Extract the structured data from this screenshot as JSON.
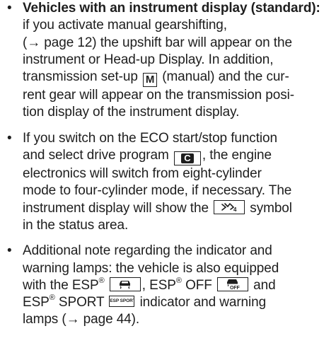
{
  "items": [
    {
      "lines": [
        {
          "parts": [
            "Vehicles with an instrument display (standard):"
          ]
        },
        {
          "parts": [
            "if you activate manual gearshifting,"
          ]
        },
        {
          "parts": [
            "(→ page 12) the upshift bar will appear on the"
          ]
        },
        {
          "parts": [
            "instrument or Head-up Display. In addition,"
          ]
        },
        {
          "parts": [
            "transmission set-up",
            "(manual) and the cur-"
          ]
        },
        {
          "parts": [
            "rent gear will appear on the transmission posi-"
          ]
        },
        {
          "parts": [
            "tion display of the instrument display."
          ]
        }
      ]
    },
    {
      "lines": [
        {
          "parts": [
            "If you switch on the ECO start/stop function"
          ]
        },
        {
          "parts": [
            "and select drive program",
            ", the engine"
          ]
        },
        {
          "parts": [
            "electronics will switch from eight-cylinder"
          ]
        },
        {
          "parts": [
            "mode to four-cylinder mode, if necessary. The"
          ]
        },
        {
          "parts": [
            "instrument display will show the",
            "symbol"
          ]
        },
        {
          "parts": [
            "in the status area."
          ]
        }
      ]
    },
    {
      "lines": [
        {
          "parts": [
            "Additional note regarding the indicator and"
          ]
        },
        {
          "parts": [
            "warning lamps: the vehicle is also equipped"
          ]
        },
        {
          "parts": [
            "with the ESP",
            ", ESP",
            "OFF",
            "and"
          ]
        },
        {
          "parts": [
            "ESP",
            "SPORT",
            "indicator and warning"
          ]
        },
        {
          "parts": [
            "lamps (→ page 44)."
          ]
        }
      ]
    }
  ],
  "sup_registered": "®",
  "bullet": "•",
  "symbols": {
    "manual": "M",
    "program_c": "C",
    "cylinder_icon": "four-cylinder-mode-icon",
    "esp_icon": "esp-skid-car-icon",
    "esp_off_icon": "esp-off-skid-car-icon",
    "esp_sport": "ESP SPORT"
  }
}
